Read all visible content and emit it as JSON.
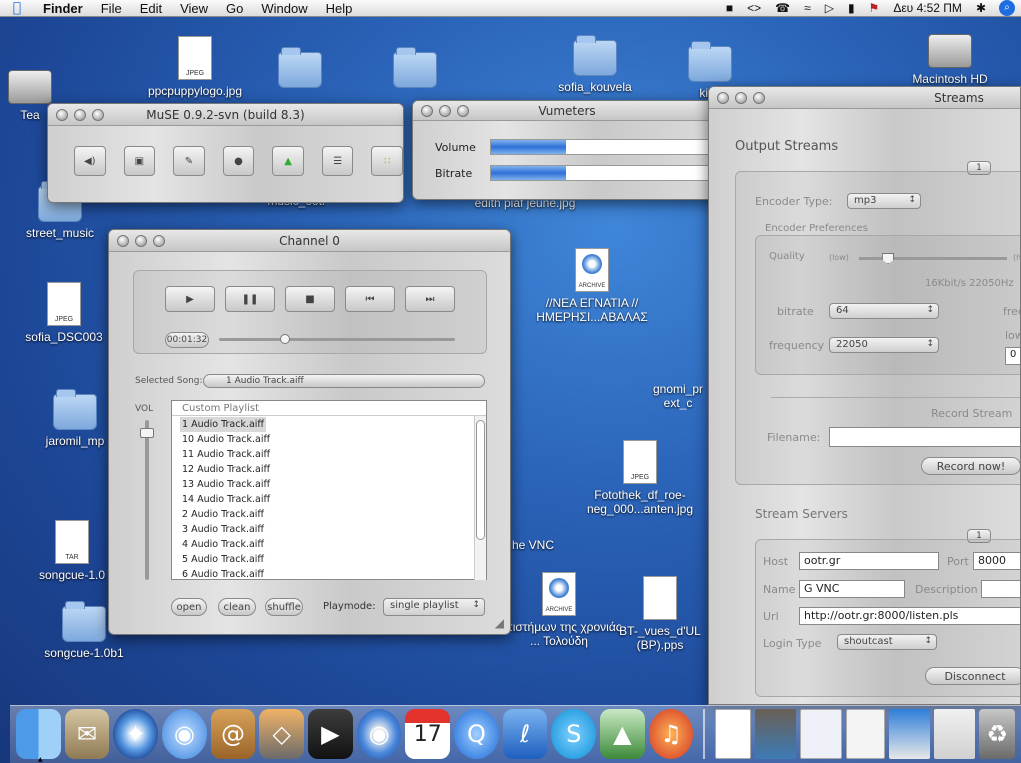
{
  "menubar": {
    "apple": "",
    "app": "Finder",
    "items": [
      "File",
      "Edit",
      "View",
      "Go",
      "Window",
      "Help"
    ],
    "status_icons": [
      "lock-icon",
      "code-icon",
      "phone-icon",
      "wifi-icon",
      "volume-icon",
      "battery-icon",
      "flag-icon"
    ],
    "clock": "Δευ 4:52 ΠΜ",
    "bluetooth": "✱",
    "spotlight": "⌕"
  },
  "desktop": {
    "icons": [
      {
        "label": "Tea",
        "type": "hd"
      },
      {
        "label": "ppcpuppylogo.jpg",
        "type": "jpeg"
      },
      {
        "label": "sofia_kouvela",
        "type": "folder"
      },
      {
        "label": "kika",
        "type": "folder"
      },
      {
        "label": "Macintosh HD",
        "type": "hd"
      },
      {
        "label": "street_music",
        "type": "folder"
      },
      {
        "label": "sofia_DSC003",
        "type": "jpeg"
      },
      {
        "label": "jaromil_mp",
        "type": "folder"
      },
      {
        "label": "songcue-1.0",
        "type": "tar"
      },
      {
        "label": "songcue-1.0b1",
        "type": "folder"
      },
      {
        "label": "//ΝΕΑ ΕΓΝΑΤΙΑ // ΗΜΕΡΗΣΙ...ΑΒΑΛΑΣ",
        "type": "archive"
      },
      {
        "label": "gnomi_pr ext_c",
        "type": "doc"
      },
      {
        "label": "Fotothek_df_roe-neg_000...anten.jpg",
        "type": "jpeg"
      },
      {
        "label": "he VNC",
        "type": "app"
      },
      {
        "label": "Επιστήμων της χρονιάς ... Τολούδη",
        "type": "archive"
      },
      {
        "label": "BT-_vues_d'UL (BP).pps",
        "type": "doc"
      },
      {
        "label": "edith piaf jeune.jpg",
        "type": "jpeg"
      },
      {
        "label": "music_ooti",
        "type": "folder"
      }
    ]
  },
  "muse": {
    "title": "MuSE 0.9.2-svn (build 8.3)",
    "tools": [
      "speaker-icon",
      "stream-icon",
      "settings-icon",
      "mic-icon",
      "user-icon",
      "list-icon",
      "grid-icon"
    ]
  },
  "vumeters": {
    "title": "Vumeters",
    "volume_label": "Volume",
    "bitrate_label": "Bitrate",
    "volume_level": 0.33,
    "bitrate_level": 0.33
  },
  "channel": {
    "title": "Channel 0",
    "time": "00:01:32",
    "position": 0.27,
    "selected_song_label": "Selected Song:",
    "selected_song": "1 Audio Track.aiff",
    "vol_label": "VOL",
    "volume_level": 0.95,
    "playlist_header": "Custom Playlist",
    "playlist": [
      "1 Audio Track.aiff",
      "10 Audio Track.aiff",
      "11 Audio Track.aiff",
      "12 Audio Track.aiff",
      "13 Audio Track.aiff",
      "14 Audio Track.aiff",
      "2 Audio Track.aiff",
      "3 Audio Track.aiff",
      "4 Audio Track.aiff",
      "5 Audio Track.aiff",
      "6 Audio Track.aiff"
    ],
    "open": "open",
    "clean": "clean",
    "shuffle": "shuffle",
    "playmode_label": "Playmode:",
    "playmode": "single playlist"
  },
  "streams": {
    "title": "Streams",
    "output_streams": "Output Streams",
    "stream_num": "1",
    "encoder_type_label": "Encoder Type:",
    "encoder_type": "mp3",
    "encoder_prefs": "Encoder Preferences",
    "quality_label": "Quality",
    "quality_low": "(low)",
    "quality_high": "(hi",
    "quality_level": 0.17,
    "quality_readout": "16Kbit/s 22050Hz",
    "bitrate_label": "bitrate",
    "bitrate": "64",
    "frequency_label": "frequency",
    "frequency": "22050",
    "freq_cut": "frec",
    "low_cut": "low",
    "zero": "0",
    "record_stream": "Record Stream",
    "filename_label": "Filename:",
    "record_now": "Record now!",
    "stream_servers": "Stream Servers",
    "server_num": "1",
    "host_label": "Host",
    "host": "ootr.gr",
    "port_label": "Port",
    "port": "8000",
    "name_label": "Name",
    "name": "G VNC",
    "description_label": "Description",
    "url_label": "Url",
    "url": "http://ootr.gr:8000/listen.pls",
    "login_type_label": "Login Type",
    "login_type": "shoutcast",
    "disconnect": "Disconnect"
  },
  "dock": {
    "apps": [
      "finder-icon",
      "mail-icon",
      "safari-icon",
      "ichat-icon",
      "addressbook-icon",
      "iphoto-icon",
      "imovie-icon",
      "idvd-icon",
      "ical-icon",
      "quicktime-icon",
      "izotope-icon",
      "skype-icon",
      "vnc-icon",
      "muse-icon"
    ],
    "calendar_day": "17",
    "minimized": [
      "window-1",
      "window-2",
      "window-3",
      "window-4",
      "window-5",
      "window-6"
    ],
    "trash": "trash-icon"
  }
}
